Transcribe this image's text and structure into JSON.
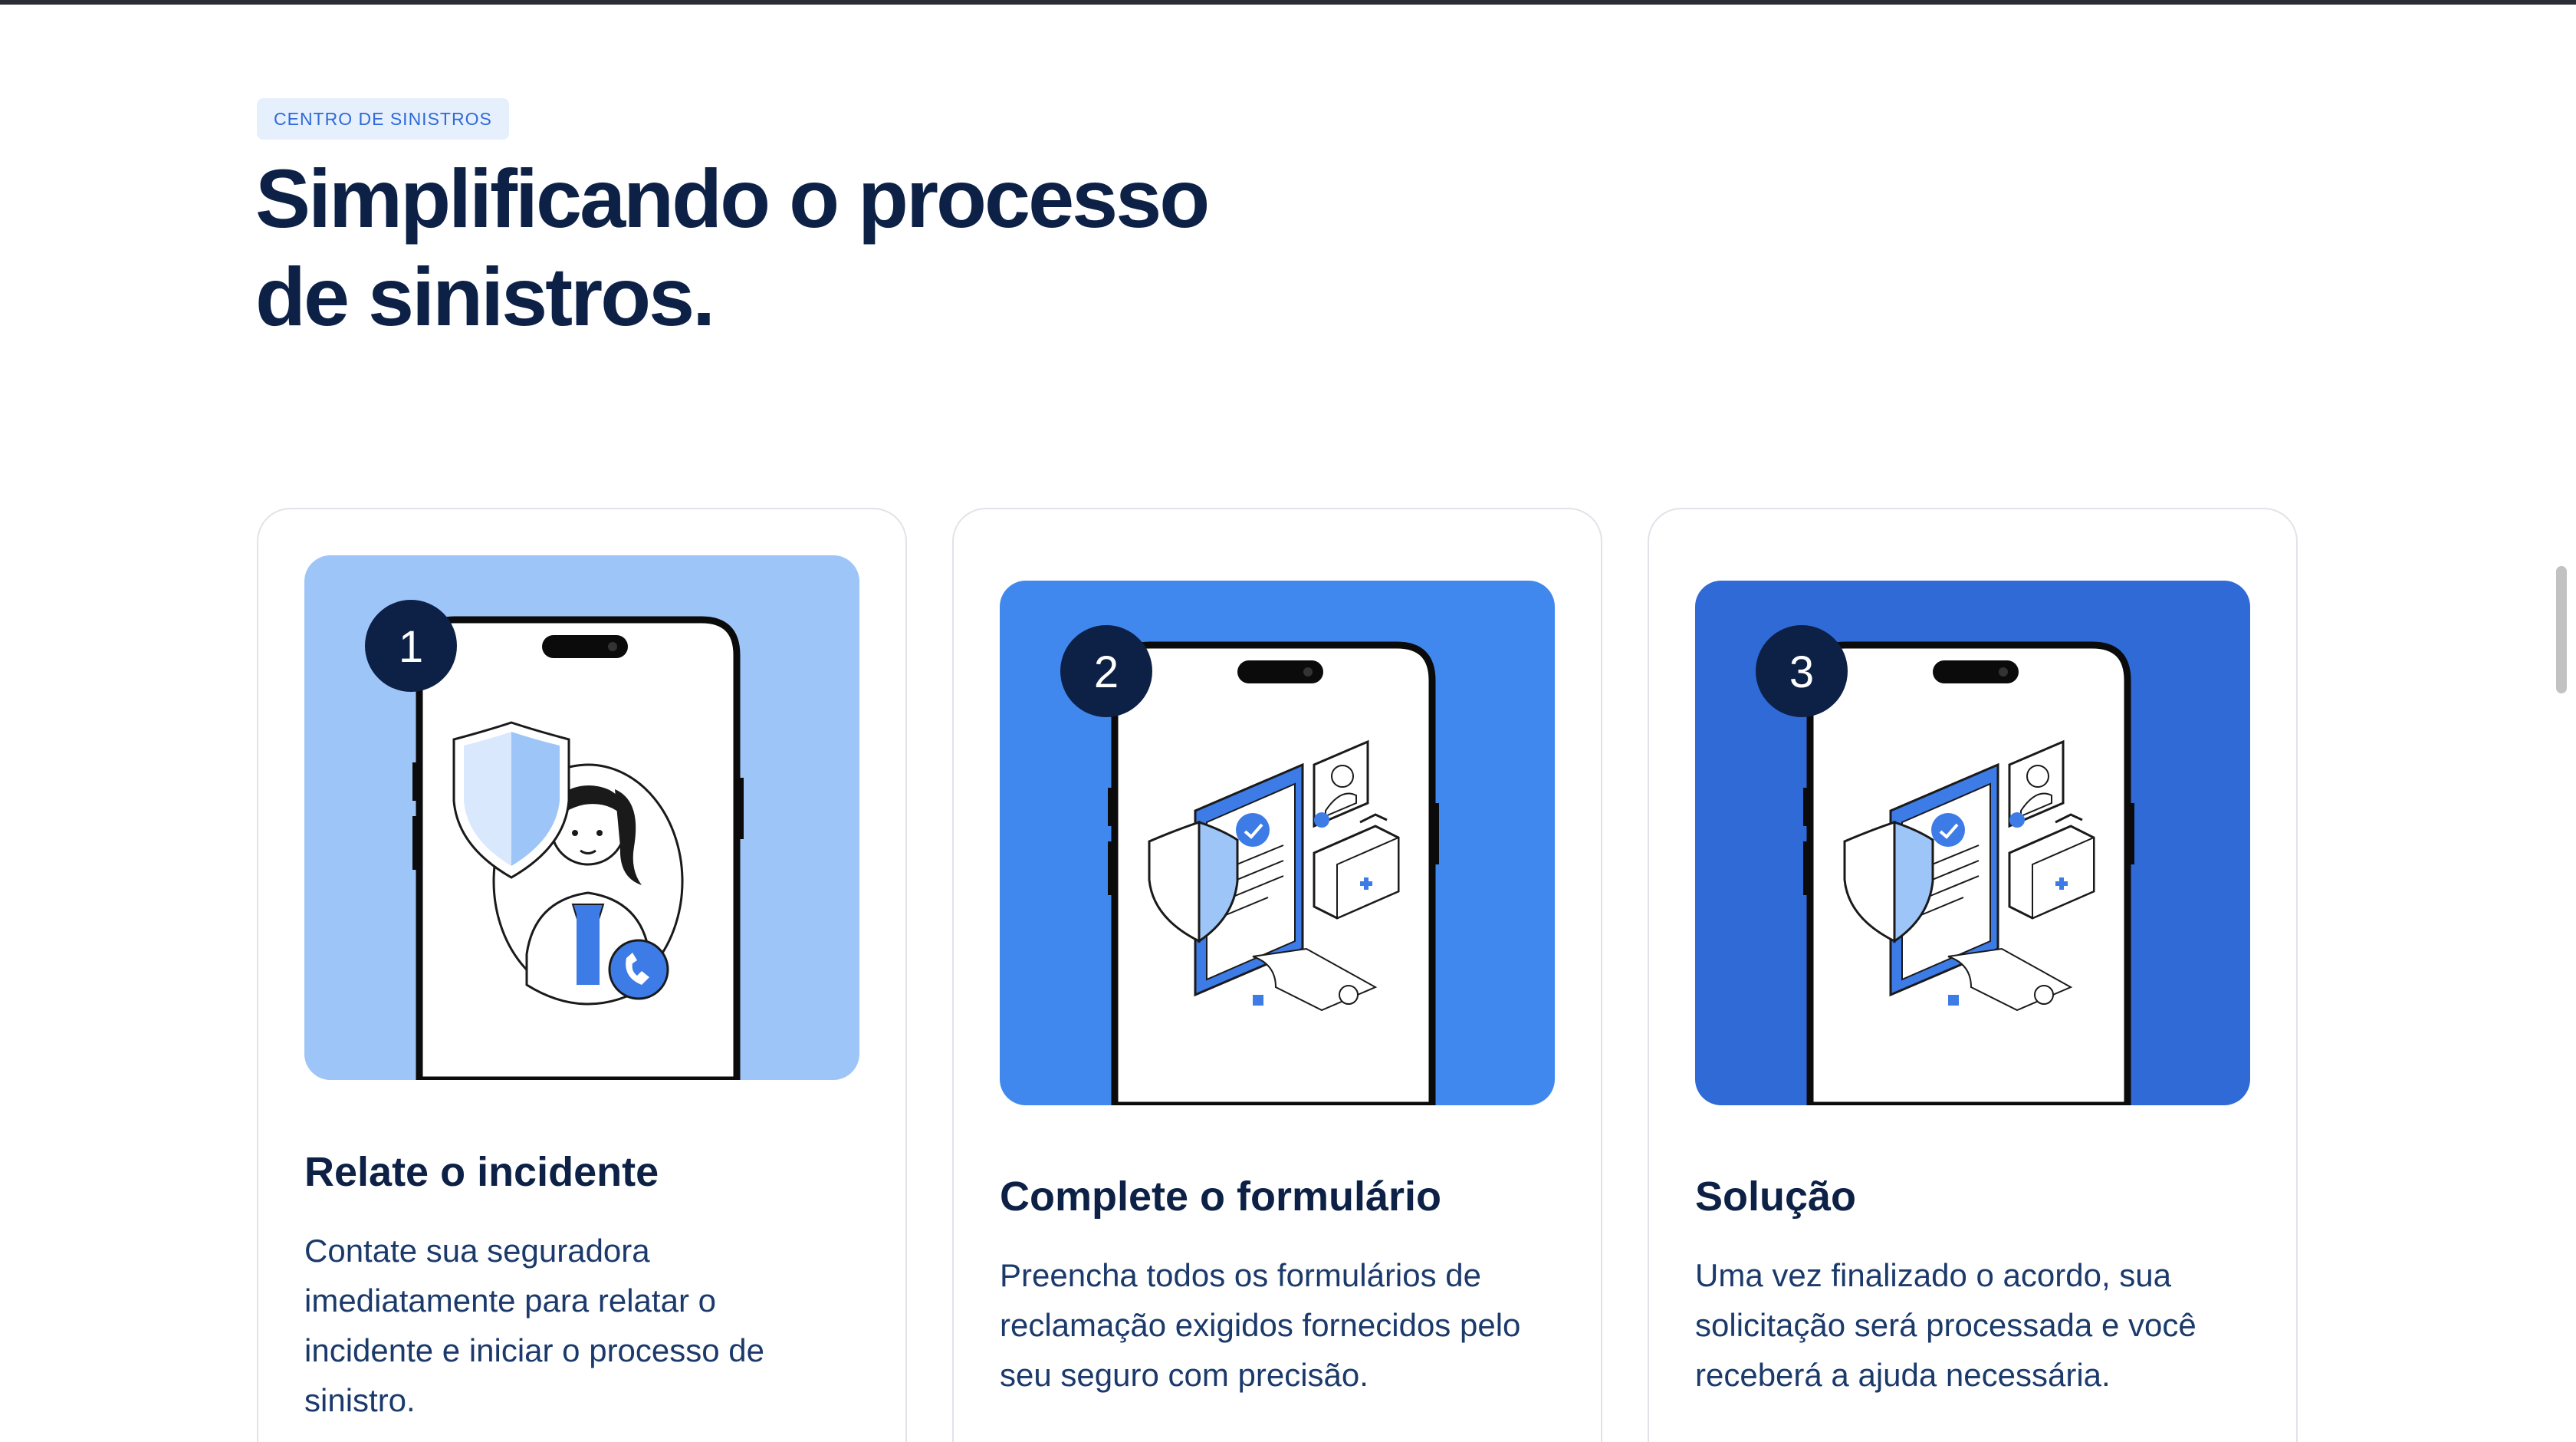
{
  "section": {
    "eyebrow": "CENTRO DE SINISTROS",
    "title_line1": "Simplificando o processo",
    "title_line2": "de sinistros."
  },
  "colors": {
    "heading": "#0d2147",
    "body_text": "#1b3a6b",
    "eyebrow_bg": "#e6f0fd",
    "eyebrow_text": "#2f6ad6",
    "step1_bg": "#9ec5f8",
    "step2_bg": "#4188ee",
    "step3_bg": "#2f6ad6",
    "badge_bg": "#0d2147"
  },
  "steps": [
    {
      "number": "1",
      "title": "Relate o incidente",
      "description": "Contate sua seguradora imediatamente para relatar o incidente e iniciar o processo de sinistro.",
      "illustration": "phone-with-agent-and-shield-icon"
    },
    {
      "number": "2",
      "title": "Complete o formulário",
      "description": "Preencha todos os formulários de reclamação exigidos fornecidos pelo seu seguro com precisão.",
      "illustration": "phone-with-claim-documents-icon"
    },
    {
      "number": "3",
      "title": "Solução",
      "description": "Uma vez finalizado o acordo, sua solicitação será processada e você receberá a ajuda necessária.",
      "illustration": "phone-with-claim-documents-icon"
    }
  ]
}
